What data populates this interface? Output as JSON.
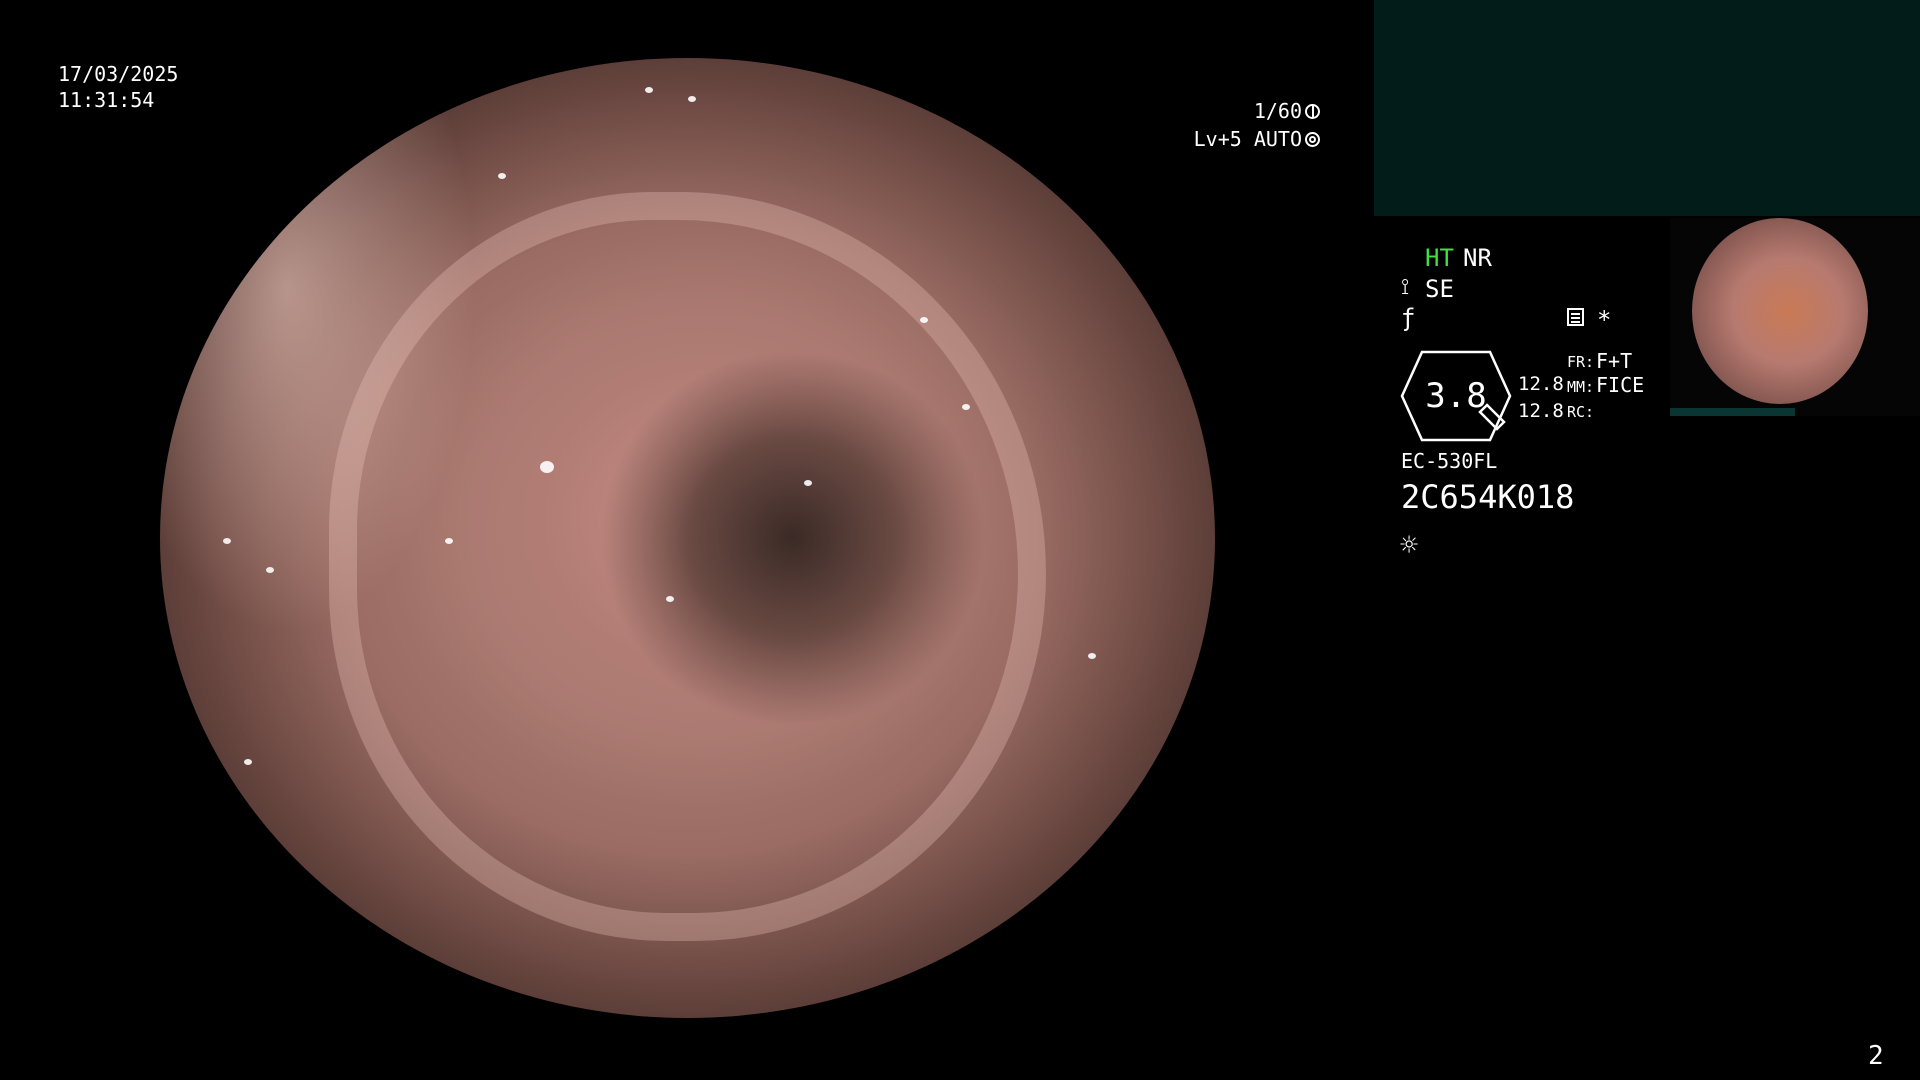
{
  "timestamp": {
    "date": "17/03/2025",
    "time": "11:31:54"
  },
  "exposure": {
    "shutter": "1/60",
    "level": "Lv+5 AUTO"
  },
  "status": {
    "ht": "HT",
    "nr": "NR",
    "se": "SE",
    "zoom": "3.8",
    "value_1": "12.8",
    "value_2": "12.8",
    "fr_label": "FR:",
    "fr_value": "F+T",
    "mm_label": "MM:",
    "mm_value": "FICE",
    "rc_label": "RC:",
    "asterisk": "*"
  },
  "scope": {
    "model": "EC-530FL",
    "serial": "2C654K018"
  },
  "page_number": "2",
  "icons": {
    "shutter": "shutter-icon",
    "auto": "auto-iris-icon",
    "se": "structure-enhance-icon",
    "f": "f-icon",
    "menu": "menu-icon",
    "light": "light-icon"
  },
  "colors": {
    "ht": "#3fe03f",
    "panel": "#021c1a",
    "background": "#000000"
  }
}
